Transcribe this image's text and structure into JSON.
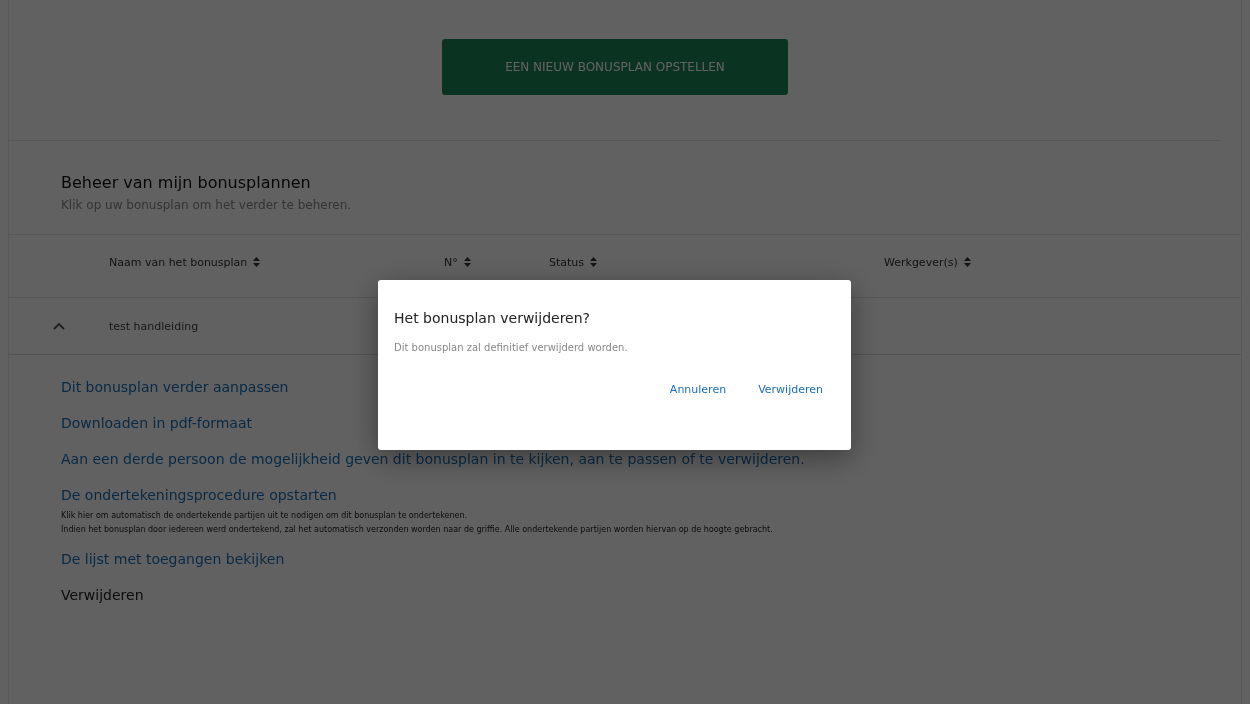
{
  "create_button": "EEN NIEUW BONUSPLAN OPSTELLEN",
  "section": {
    "title": "Beheer van mijn bonusplannen",
    "subtitle": "Klik op uw bonusplan om het verder te beheren."
  },
  "table": {
    "columns": [
      {
        "label": "Naam van het bonusplan"
      },
      {
        "label": "N°"
      },
      {
        "label": "Status"
      },
      {
        "label": "Werkgever(s)"
      }
    ],
    "rows": [
      {
        "name": "test handleiding",
        "expanded": true
      }
    ]
  },
  "actions": [
    {
      "kind": "link",
      "label": "Dit bonusplan verder aanpassen"
    },
    {
      "kind": "link",
      "label": "Downloaden in pdf-formaat"
    },
    {
      "kind": "link",
      "label": "Aan een derde persoon de mogelijkheid geven dit bonusplan in te kijken, aan te passen of te verwijderen."
    },
    {
      "kind": "link",
      "label": "De ondertekeningsprocedure opstarten",
      "notes": [
        "Klik hier om automatisch de ondertekende partijen uit te nodigen om dit bonusplan te ondertekenen.",
        "Indien het bonusplan door iedereen werd ondertekend, zal het automatisch verzonden worden naar de griffie. Alle ondertekende partijen worden hiervan op de hoogte gebracht."
      ]
    },
    {
      "kind": "link",
      "label": "De lijst met toegangen bekijken"
    },
    {
      "kind": "danger",
      "label": "Verwijderen"
    }
  ],
  "dialog": {
    "title": "Het bonusplan verwijderen?",
    "message": "Dit bonusplan zal definitief verwijderd worden.",
    "buttons": [
      "Annuleren",
      "Verwijderen"
    ]
  }
}
